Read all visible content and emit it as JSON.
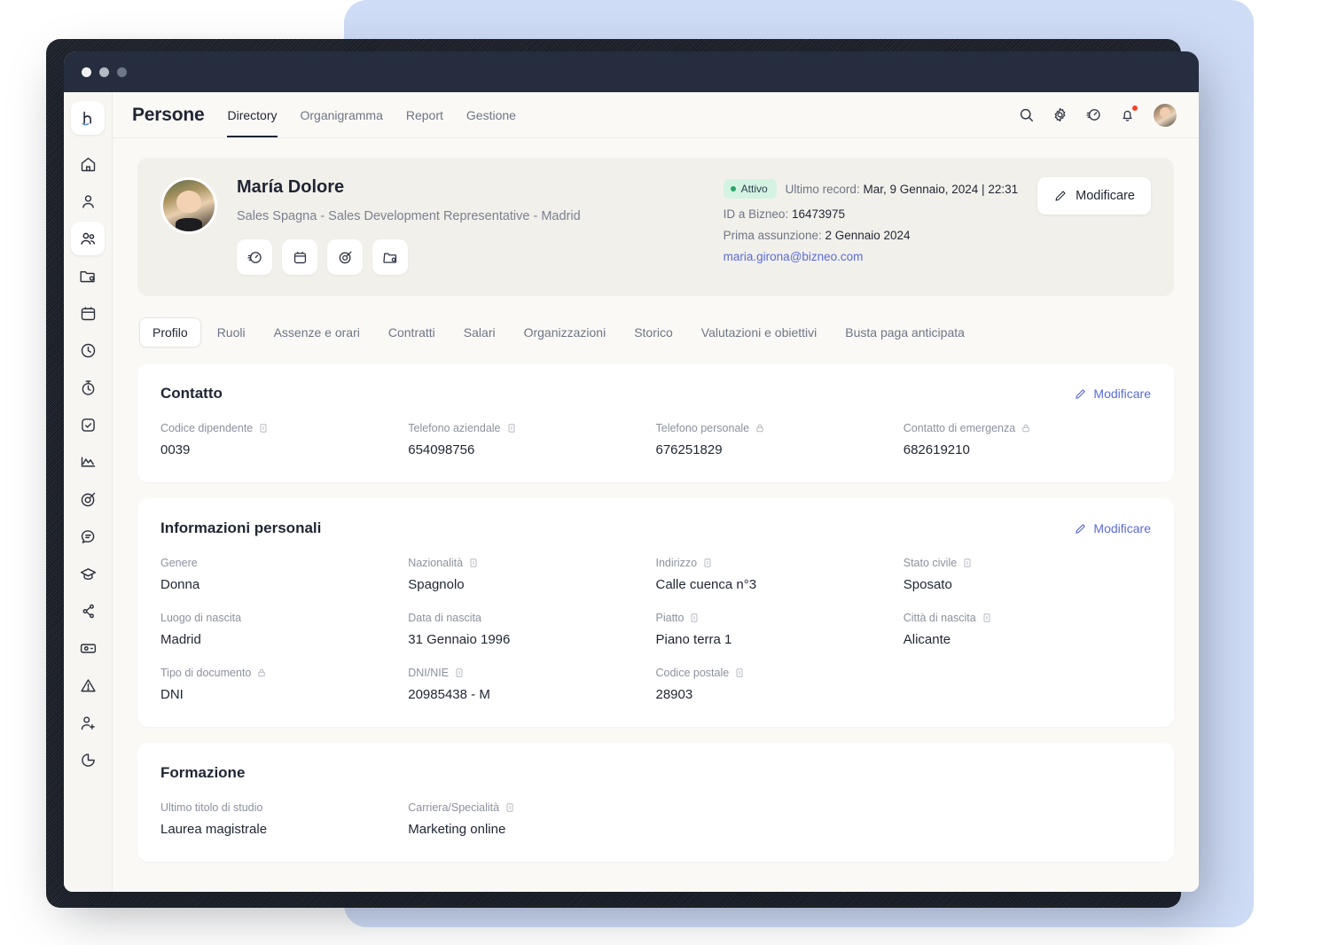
{
  "window": {
    "traffic_lights": [
      "close",
      "minimize",
      "maximize"
    ]
  },
  "topbar": {
    "brand": "Persone",
    "nav": [
      {
        "label": "Directory",
        "active": true
      },
      {
        "label": "Organigramma",
        "active": false
      },
      {
        "label": "Report",
        "active": false
      },
      {
        "label": "Gestione",
        "active": false
      }
    ],
    "icons": [
      "search-icon",
      "gear-icon",
      "gauge-icon",
      "bell-icon"
    ],
    "avatar": "user-avatar"
  },
  "sidebar": {
    "items": [
      {
        "icon": "logo-icon",
        "active": false,
        "is_logo": true
      },
      {
        "icon": "home-icon",
        "active": false
      },
      {
        "icon": "user-icon",
        "active": false
      },
      {
        "icon": "people-icon",
        "active": true
      },
      {
        "icon": "folder-icon",
        "active": false
      },
      {
        "icon": "calendar-icon",
        "active": false
      },
      {
        "icon": "clock-icon",
        "active": false
      },
      {
        "icon": "stopwatch-icon",
        "active": false
      },
      {
        "icon": "check-square-icon",
        "active": false
      },
      {
        "icon": "chart-line-icon",
        "active": false
      },
      {
        "icon": "target-icon",
        "active": false
      },
      {
        "icon": "chat-icon",
        "active": false
      },
      {
        "icon": "graduation-cap-icon",
        "active": false
      },
      {
        "icon": "workflow-icon",
        "active": false
      },
      {
        "icon": "money-icon",
        "active": false
      },
      {
        "icon": "alert-icon",
        "active": false
      },
      {
        "icon": "user-plus-icon",
        "active": false
      },
      {
        "icon": "pie-chart-icon",
        "active": false
      }
    ]
  },
  "profile": {
    "name": "María Dolore",
    "role": "Sales Spagna - Sales Development Representative - Madrid",
    "action_buttons": [
      "gauge-icon",
      "calendar-icon",
      "target-icon",
      "folder-icon"
    ],
    "status_badge": "Attivo",
    "last_record_label": "Ultimo record:",
    "last_record_value": "Mar, 9 Gennaio, 2024 | 22:31",
    "id_label": "ID a Bizneo:",
    "id_value": "16473975",
    "hire_label": "Prima assunzione:",
    "hire_value": "2 Gennaio 2024",
    "email": "maria.girona@bizneo.com",
    "edit_label": "Modificare"
  },
  "section_tabs": [
    {
      "label": "Profilo",
      "active": true
    },
    {
      "label": "Ruoli",
      "active": false
    },
    {
      "label": "Assenze e orari",
      "active": false
    },
    {
      "label": "Contratti",
      "active": false
    },
    {
      "label": "Salari",
      "active": false
    },
    {
      "label": "Organizzazioni",
      "active": false
    },
    {
      "label": "Storico",
      "active": false
    },
    {
      "label": "Valutazioni e obiettivi",
      "active": false
    },
    {
      "label": "Busta paga anticipata",
      "active": false
    }
  ],
  "contatto": {
    "title": "Contatto",
    "edit_label": "Modificare",
    "fields": [
      {
        "label": "Codice dipendente",
        "icon": "note-icon",
        "value": "0039"
      },
      {
        "label": "Telefono aziendale",
        "icon": "note-icon",
        "value": "654098756"
      },
      {
        "label": "Telefono personale",
        "icon": "lock-icon",
        "value": "676251829"
      },
      {
        "label": "Contatto di emergenza",
        "icon": "lock-icon",
        "value": "682619210"
      }
    ]
  },
  "informazioni_personali": {
    "title": "Informazioni personali",
    "edit_label": "Modificare",
    "fields": [
      {
        "label": "Genere",
        "icon": "",
        "value": "Donna"
      },
      {
        "label": "Nazionalità",
        "icon": "note-icon",
        "value": "Spagnolo"
      },
      {
        "label": "Indirizzo",
        "icon": "note-icon",
        "value": "Calle cuenca n°3"
      },
      {
        "label": "Stato civile",
        "icon": "note-icon",
        "value": "Sposato"
      },
      {
        "label": "Luogo di nascita",
        "icon": "",
        "value": "Madrid"
      },
      {
        "label": "Data di nascita",
        "icon": "",
        "value": "31 Gennaio 1996"
      },
      {
        "label": "Piatto",
        "icon": "note-icon",
        "value": "Piano terra 1"
      },
      {
        "label": "Città di nascita",
        "icon": "note-icon",
        "value": "Alicante"
      },
      {
        "label": "Tipo di documento",
        "icon": "lock-icon",
        "value": "DNI"
      },
      {
        "label": "DNI/NIE",
        "icon": "note-icon",
        "value": "20985438 - M"
      },
      {
        "label": "Codice postale",
        "icon": "note-icon",
        "value": "28903"
      }
    ]
  },
  "formazione": {
    "title": "Formazione",
    "fields": [
      {
        "label": "Ultimo titolo di studio",
        "icon": "",
        "value": "Laurea magistrale"
      },
      {
        "label": "Carriera/Specialità",
        "icon": "note-icon",
        "value": "Marketing online"
      }
    ]
  },
  "colors": {
    "accent": "#5a6bd8",
    "badge_bg": "#d5f3e2",
    "badge_dot": "#27a567",
    "titlebar": "#252d3f",
    "panel_blue": "#cfdcf6",
    "notification": "#f0422e"
  }
}
